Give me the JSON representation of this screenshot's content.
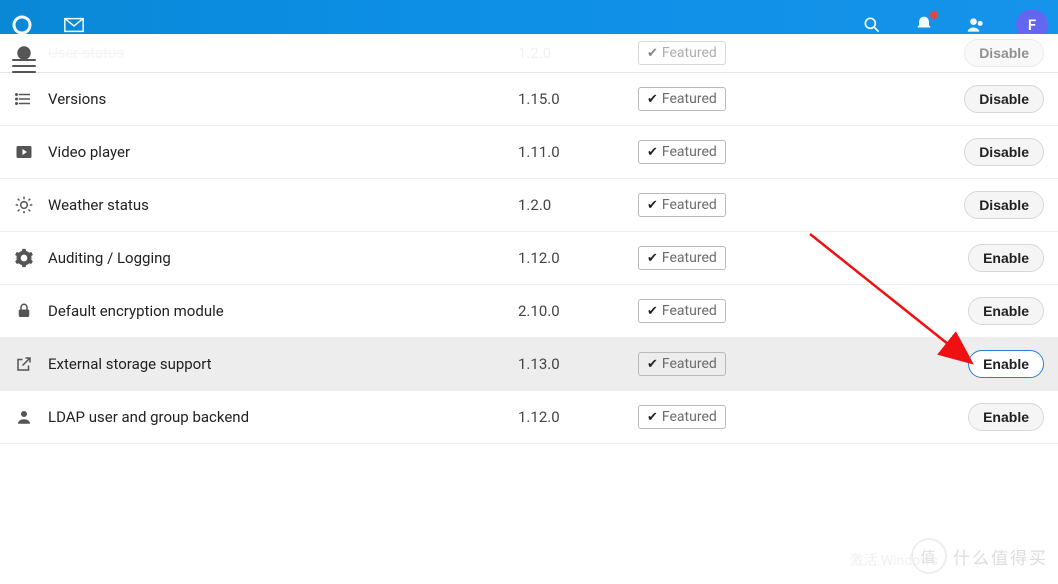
{
  "header": {
    "avatar_letter": "F"
  },
  "peek_row": {
    "name": "User status",
    "version": "1.2.0",
    "featured": "Featured",
    "action": "Disable"
  },
  "apps": [
    {
      "icon": "list-icon",
      "name": "Versions",
      "version": "1.15.0",
      "featured": "Featured",
      "action": "Disable",
      "highlight": false
    },
    {
      "icon": "play-icon",
      "name": "Video player",
      "version": "1.11.0",
      "featured": "Featured",
      "action": "Disable",
      "highlight": false
    },
    {
      "icon": "weather-icon",
      "name": "Weather status",
      "version": "1.2.0",
      "featured": "Featured",
      "action": "Disable",
      "highlight": false
    },
    {
      "icon": "gear-icon",
      "name": "Auditing / Logging",
      "version": "1.12.0",
      "featured": "Featured",
      "action": "Enable",
      "highlight": false
    },
    {
      "icon": "lock-icon",
      "name": "Default encryption module",
      "version": "2.10.0",
      "featured": "Featured",
      "action": "Enable",
      "highlight": false
    },
    {
      "icon": "external-icon",
      "name": "External storage support",
      "version": "1.13.0",
      "featured": "Featured",
      "action": "Enable",
      "highlight": true
    },
    {
      "icon": "user-icon",
      "name": "LDAP user and group backend",
      "version": "1.12.0",
      "featured": "Featured",
      "action": "Enable",
      "highlight": false
    }
  ],
  "watermark": {
    "circle": "值",
    "text": "什么值得买"
  },
  "hidden_text": "激活 Windows"
}
